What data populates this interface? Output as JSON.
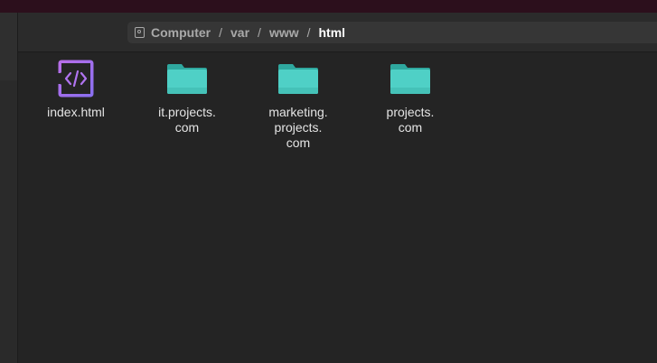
{
  "pathbar": {
    "crumbs": [
      "Computer",
      "var",
      "www",
      "html"
    ],
    "separator": "/"
  },
  "files": [
    {
      "name": "index.html",
      "icon": "html-file-icon"
    },
    {
      "name": "it.projects.\ncom",
      "icon": "folder-icon"
    },
    {
      "name": "marketing.\nprojects.\ncom",
      "icon": "folder-icon"
    },
    {
      "name": "projects.\ncom",
      "icon": "folder-icon"
    }
  ],
  "colors": {
    "folder": "#4cc9c0",
    "html_icon": "#a86ff0",
    "background": "#242424"
  }
}
